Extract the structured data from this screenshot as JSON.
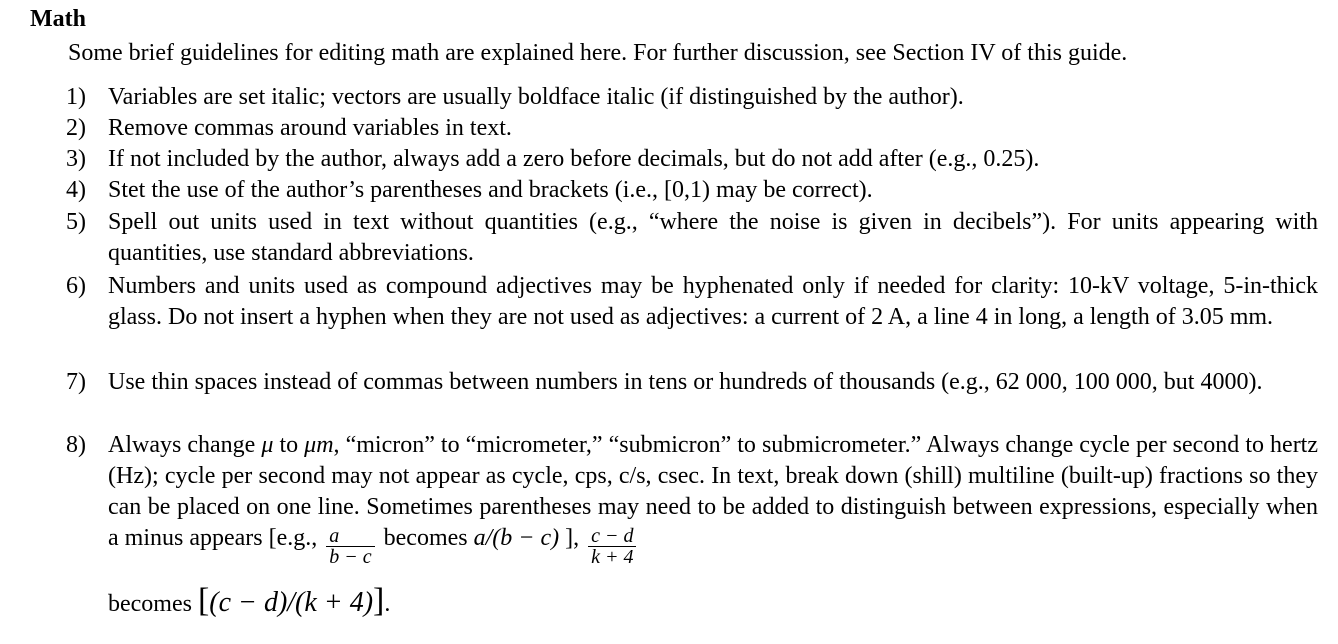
{
  "heading": "Math",
  "intro": "Some brief guidelines for editing math are explained here. For further discussion, see Section IV of this guide.",
  "items": [
    {
      "num": "1)",
      "text": "Variables are set italic; vectors are usually boldface italic (if distinguished by the author)."
    },
    {
      "num": "2)",
      "text": "Remove commas around variables in text."
    },
    {
      "num": "3)",
      "text": "If not included by the author, always add a zero before decimals, but do not add after (e.g., 0.25)."
    },
    {
      "num": "4)",
      "text": "Stet the use of the author’s parentheses and brackets (i.e., [0,1) may be correct)."
    },
    {
      "num": "5)",
      "text": "Spell out units used in text without quantities (e.g., “where the noise is given in decibels”). For units appearing with quantities, use standard abbreviations."
    },
    {
      "num": "6)",
      "text": "Numbers and units used as compound adjectives may be hyphenated only if needed for clarity: 10-kV voltage, 5-in-thick glass. Do not insert a hyphen when they are not used as adjectives: a current of 2 A, a line 4 in long, a length of 3.05 mm."
    },
    {
      "num": "7)",
      "text": "Use thin spaces instead of commas between numbers in tens or hundreds of thousands (e.g., 62 000, 100 000, but 4000)."
    },
    {
      "num": "8)",
      "part1": "Always change ",
      "mu": "μ",
      "part2": " to ",
      "mum": "μm",
      "part3": ", “micron” to “micrometer,” “submicron” to submicrometer.” Always change cycle per second to hertz (Hz); cycle per second may not appear as cycle, cps, c/s, csec. In text, break down (shill) multiline (built-up) fractions so they can be placed on one line. Sometimes parentheses may need to be added to distinguish between expressions, especially when a minus appears [e.g., ",
      "frac1_num": "a",
      "frac1_den": "b − c",
      "becomes1": " becomes ",
      "expr1": "a/(b − c)",
      "after1": " ], ",
      "frac2_num": "c − d",
      "frac2_den": "k + 4",
      "becomes2": "becomes ",
      "expr2_open": "[",
      "expr2": "(c − d)/(k + 4)",
      "expr2_close": "]",
      "end": "."
    }
  ]
}
